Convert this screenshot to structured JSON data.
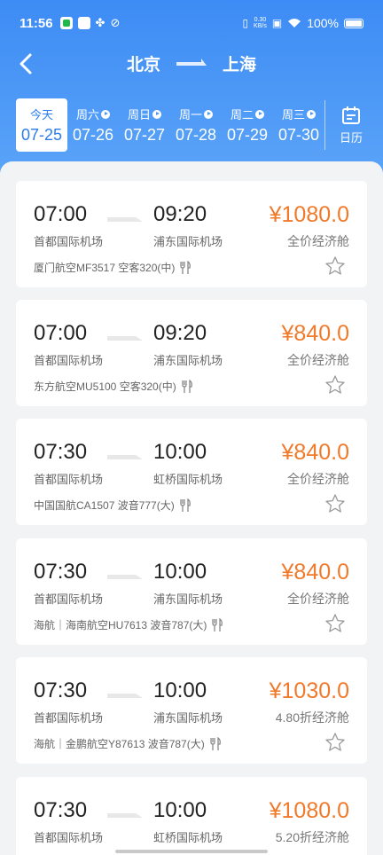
{
  "status": {
    "time": "11:56",
    "net_speed_top": "0.30",
    "net_speed_bottom": "KB/s",
    "battery": "100%"
  },
  "nav": {
    "from": "北京",
    "to": "上海"
  },
  "dates": [
    {
      "week": "今天",
      "date": "07-25",
      "active": true
    },
    {
      "week": "周六",
      "date": "07-26"
    },
    {
      "week": "周日",
      "date": "07-27"
    },
    {
      "week": "周一",
      "date": "07-28"
    },
    {
      "week": "周二",
      "date": "07-29"
    },
    {
      "week": "周三",
      "date": "07-30"
    }
  ],
  "calendar_label": "日历",
  "flights": [
    {
      "dep_time": "07:00",
      "arr_time": "09:20",
      "dep_airport": "首都国际机场",
      "arr_airport": "浦东国际机场",
      "price": "¥1080.0",
      "cabin": "全价经济舱",
      "info": "厦门航空MF3517  空客320(中)"
    },
    {
      "dep_time": "07:00",
      "arr_time": "09:20",
      "dep_airport": "首都国际机场",
      "arr_airport": "浦东国际机场",
      "price": "¥840.0",
      "cabin": "全价经济舱",
      "info": "东方航空MU5100  空客320(中)"
    },
    {
      "dep_time": "07:30",
      "arr_time": "10:00",
      "dep_airport": "首都国际机场",
      "arr_airport": "虹桥国际机场",
      "price": "¥840.0",
      "cabin": "全价经济舱",
      "info": "中国国航CA1507  波音777(大)"
    },
    {
      "dep_time": "07:30",
      "arr_time": "10:00",
      "dep_airport": "首都国际机场",
      "arr_airport": "浦东国际机场",
      "price": "¥840.0",
      "cabin": "全价经济舱",
      "info": "海航｜海南航空HU7613  波音787(大)"
    },
    {
      "dep_time": "07:30",
      "arr_time": "10:00",
      "dep_airport": "首都国际机场",
      "arr_airport": "浦东国际机场",
      "price": "¥1030.0",
      "cabin": "4.80折经济舱",
      "info": "海航｜金鹏航空Y87613  波音787(大)"
    },
    {
      "dep_time": "07:30",
      "arr_time": "10:00",
      "dep_airport": "首都国际机场",
      "arr_airport": "虹桥国际机场",
      "price": "¥1080.0",
      "cabin": "5.20折经济舱",
      "info": ""
    }
  ],
  "colors": {
    "header": "#3d8cf5",
    "price": "#f07a2a",
    "active_date": "#2a7cf0"
  }
}
